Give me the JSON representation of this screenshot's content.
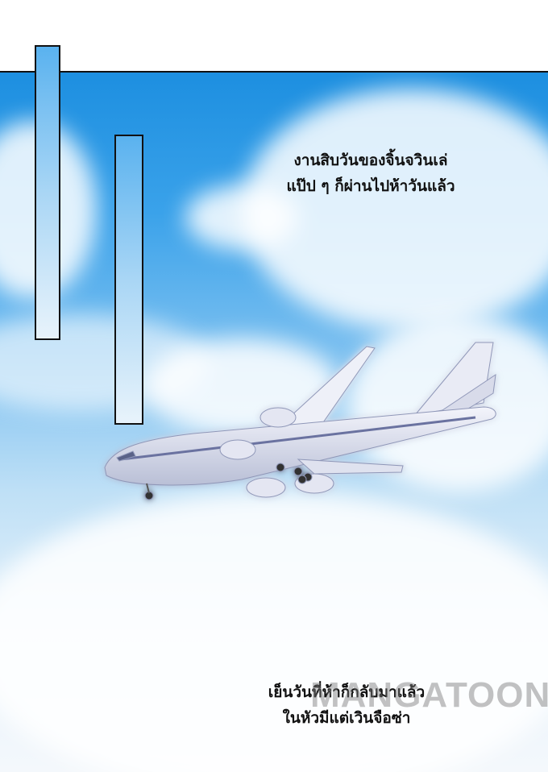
{
  "captions": {
    "top_line1": "งานสิบวันของจิ้นจวินเล่",
    "top_line2": "แป๊ป ๆ ก็ผ่านไปห้าวันแล้ว",
    "bottom_line1": "เย็นวันที่ห้าก็กลับมาแล้ว",
    "bottom_line2": "ในหัวมีแต่เวินจือซ่า"
  },
  "watermark": "MANGATOON",
  "colors": {
    "sky_top": "#1d8fe0",
    "sky_bottom": "#f4f8fc",
    "border": "#111111"
  },
  "icons": [
    "airplane-illustration"
  ]
}
